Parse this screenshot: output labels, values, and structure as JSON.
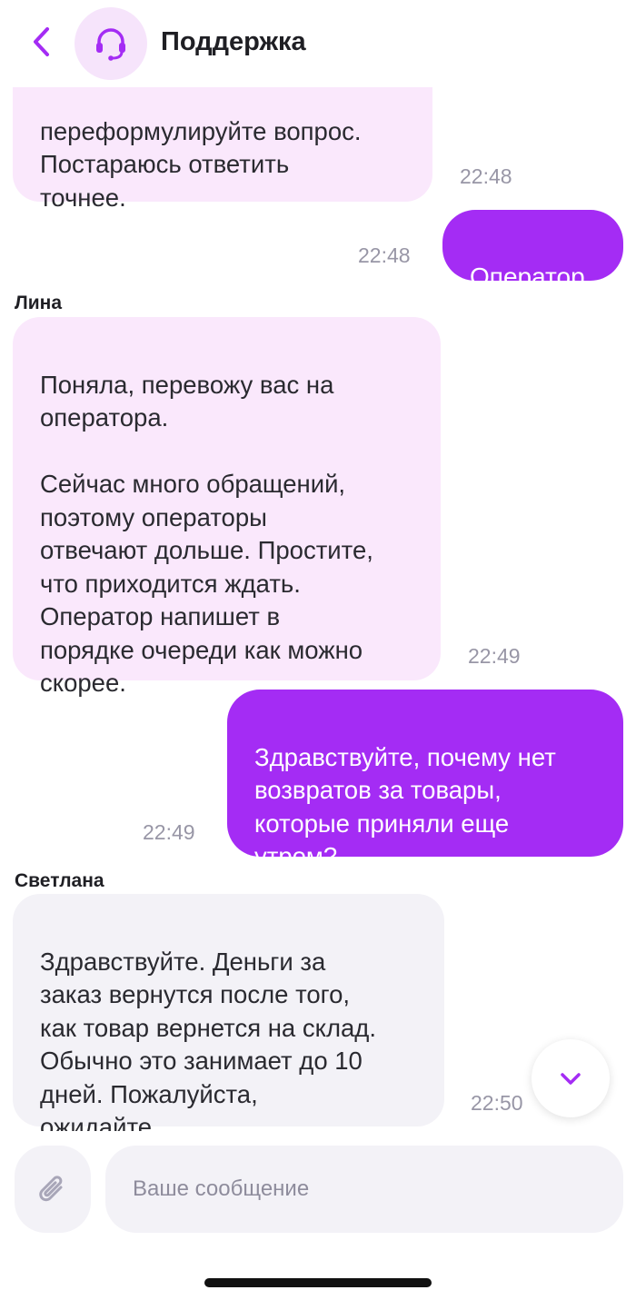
{
  "header": {
    "title": "Поддержка"
  },
  "messages": [
    {
      "direction": "incoming",
      "sender": "",
      "text": "переформулируйте вопрос.\nПостараюсь ответить\nточнее.",
      "time": "22:48"
    },
    {
      "direction": "outgoing",
      "text": "Оператор",
      "time": "22:48"
    },
    {
      "direction": "incoming",
      "sender": "Лина",
      "text": "Поняла, перевожу вас на\nоператора.\n\nСейчас много обращений,\nпоэтому операторы\nотвечают дольше. Простите,\nчто приходится ждать.\nОператор напишет в\nпорядке очереди как можно\nскорее.",
      "time": "22:49"
    },
    {
      "direction": "outgoing",
      "text": "Здравствуйте, почему нет\nвозвратов за товары,\nкоторые приняли еще\nутром?",
      "time": "22:49"
    },
    {
      "direction": "incoming",
      "sender": "Светлана",
      "text": "Здравствуйте. Деньги за\nзаказ вернутся после того,\nкак товар вернется на склад.\nОбычно это занимает до 10\nдней. Пожалуйста,\nожидайте.",
      "time": "22:50"
    }
  ],
  "composer": {
    "placeholder": "Ваше сообщение"
  },
  "colors": {
    "accent": "#a42cf4",
    "incoming_bubble": "#fae8fc",
    "incoming_bubble_latest": "#f3f2f7",
    "icon_purple": "#a42cf4",
    "time_gray": "#9896a6"
  },
  "icons": {
    "back": "chevron-left-icon",
    "avatar": "headset-icon",
    "scroll": "chevron-down-icon",
    "attach": "paperclip-icon"
  }
}
